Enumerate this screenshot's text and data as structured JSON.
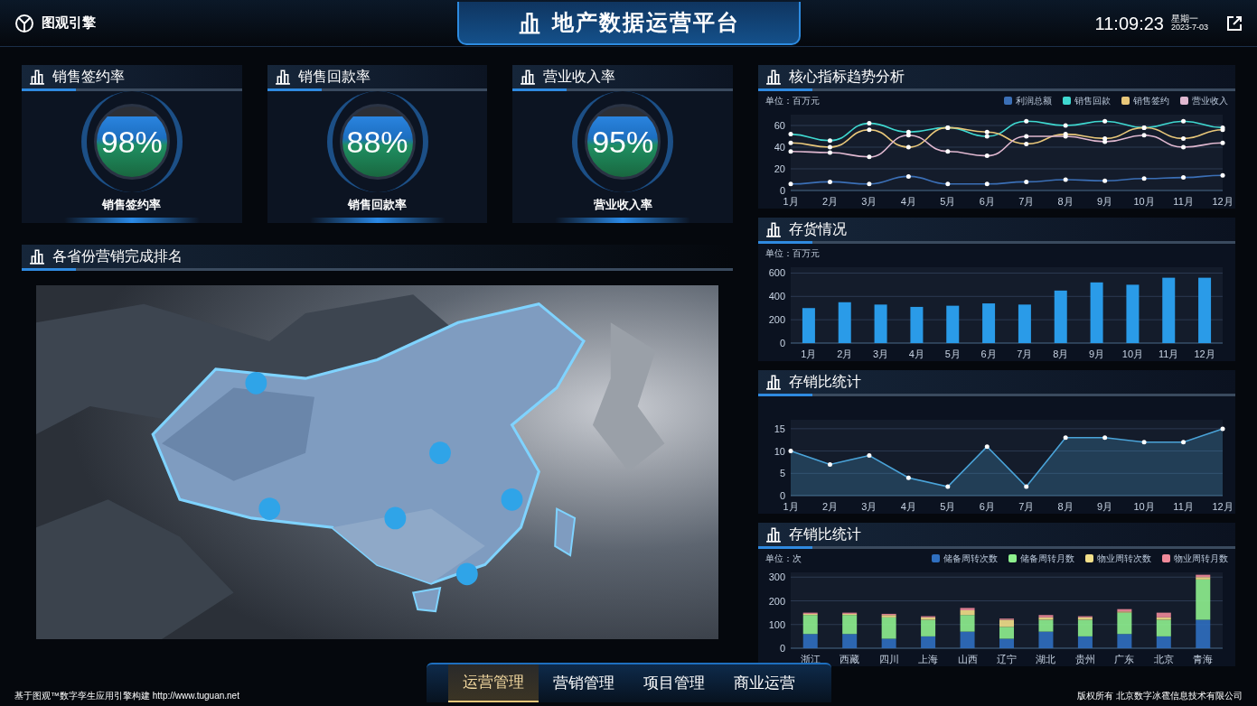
{
  "header": {
    "brand": "图观引擎",
    "title": "地产数据运营平台",
    "time": "11:09:23",
    "weekday": "星期一",
    "date": "2023-7-03"
  },
  "gauges": [
    {
      "title": "销售签约率",
      "value": "98%",
      "label": "销售签约率"
    },
    {
      "title": "销售回款率",
      "value": "88%",
      "label": "销售回款率"
    },
    {
      "title": "营业收入率",
      "value": "95%",
      "label": "营业收入率"
    }
  ],
  "map_panel": {
    "title": "各省份营销完成排名"
  },
  "panels": [
    {
      "title": "核心指标趋势分析",
      "unit": "单位：百万元",
      "chart_data": {
        "type": "line",
        "categories": [
          "1月",
          "2月",
          "3月",
          "4月",
          "5月",
          "6月",
          "7月",
          "8月",
          "9月",
          "10月",
          "11月",
          "12月"
        ],
        "ylim": [
          0,
          70
        ],
        "grid": true,
        "yticks": [
          0,
          20,
          40,
          60
        ],
        "series": [
          {
            "name": "利润总额",
            "color": "#3b6fb6",
            "values": [
              6,
              8,
              6,
              13,
              6,
              6,
              8,
              10,
              9,
              11,
              12,
              14
            ]
          },
          {
            "name": "销售回款",
            "color": "#3fd8d0",
            "values": [
              52,
              46,
              62,
              54,
              58,
              50,
              64,
              60,
              64,
              58,
              64,
              58
            ]
          },
          {
            "name": "销售签约",
            "color": "#e8c77a",
            "values": [
              44,
              40,
              56,
              40,
              58,
              54,
              43,
              52,
              48,
              58,
              48,
              56
            ]
          },
          {
            "name": "营业收入",
            "color": "#e0b8d0",
            "values": [
              36,
              35,
              31,
              51,
              36,
              32,
              50,
              50,
              45,
              51,
              40,
              44
            ]
          }
        ]
      }
    },
    {
      "title": "存货情况",
      "unit": "单位：百万元",
      "chart_data": {
        "type": "bar",
        "categories": [
          "1月",
          "2月",
          "3月",
          "4月",
          "5月",
          "6月",
          "7月",
          "8月",
          "9月",
          "10月",
          "11月",
          "12月"
        ],
        "ylim": [
          0,
          650
        ],
        "grid": true,
        "yticks": [
          0,
          200,
          400,
          600
        ],
        "series": [
          {
            "color": "#2a9be8",
            "values": [
              300,
              350,
              330,
              310,
              320,
              340,
              330,
              450,
              520,
              500,
              560,
              560
            ]
          }
        ]
      }
    },
    {
      "title": "存销比统计",
      "chart_data": {
        "type": "area",
        "categories": [
          "1月",
          "2月",
          "3月",
          "4月",
          "5月",
          "6月",
          "7月",
          "8月",
          "9月",
          "10月",
          "11月",
          "12月"
        ],
        "ylim": [
          0,
          17
        ],
        "grid": true,
        "yticks": [
          0,
          5,
          10,
          15
        ],
        "series": [
          {
            "color": "#4aa3d8",
            "values": [
              10,
              7,
              9,
              4,
              2,
              11,
              2,
              13,
              13,
              12,
              12,
              15
            ]
          }
        ]
      }
    },
    {
      "title": "存销比统计",
      "unit": "单位：次",
      "chart_data": {
        "type": "bar",
        "stacked": true,
        "categories": [
          "浙江",
          "西藏",
          "四川",
          "上海",
          "山西",
          "辽宁",
          "湖北",
          "贵州",
          "广东",
          "北京",
          "青海"
        ],
        "ylim": [
          0,
          320
        ],
        "grid": true,
        "yticks": [
          0,
          100,
          200,
          300
        ],
        "series": [
          {
            "name": "储备周转次数",
            "color": "#2f6fc0",
            "values": [
              60,
              60,
              40,
              50,
              70,
              40,
              70,
              50,
              60,
              50,
              120
            ]
          },
          {
            "name": "储备周转月数",
            "color": "#8ef08e",
            "values": [
              80,
              80,
              90,
              70,
              70,
              50,
              50,
              70,
              90,
              70,
              170
            ]
          },
          {
            "name": "物业周转次数",
            "color": "#f3e08a",
            "values": [
              5,
              5,
              10,
              10,
              20,
              30,
              10,
              10,
              5,
              10,
              10
            ]
          },
          {
            "name": "物业周转月数",
            "color": "#f08a9a",
            "values": [
              5,
              5,
              5,
              5,
              10,
              5,
              10,
              5,
              10,
              20,
              10
            ]
          }
        ]
      }
    }
  ],
  "nav": [
    {
      "label": "运营管理",
      "selected": true
    },
    {
      "label": "营销管理",
      "selected": false
    },
    {
      "label": "项目管理",
      "selected": false
    },
    {
      "label": "商业运营",
      "selected": false
    }
  ],
  "footer": {
    "left": "基于图观™数字孪生应用引擎构建 http://www.tuguan.net",
    "right": "版权所有 北京数字冰雹信息技术有限公司"
  }
}
